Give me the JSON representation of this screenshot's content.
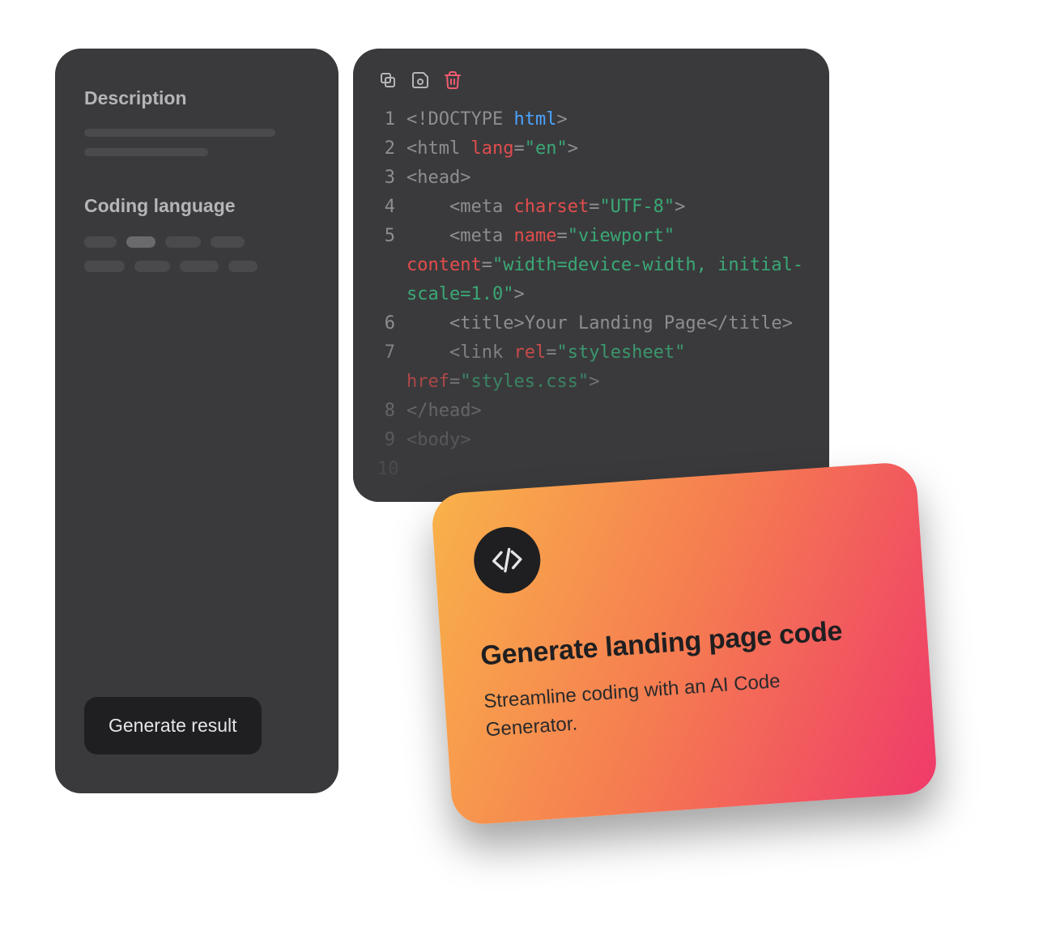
{
  "sidebar": {
    "description_label": "Description",
    "coding_language_label": "Coding language",
    "generate_button": "Generate result"
  },
  "code": {
    "lines": [
      {
        "n": "1",
        "html": "<span class='c-punc'>&lt;!DOCTYPE </span><span class='c-kw'>html</span><span class='c-punc'>&gt;</span>"
      },
      {
        "n": "2",
        "html": "<span class='c-punc'>&lt;</span><span class='c-tag'>html</span> <span class='c-attr'>lang</span><span class='c-punc'>=</span><span class='c-str'>\"en\"</span><span class='c-punc'>&gt;</span>"
      },
      {
        "n": "3",
        "html": "<span class='c-punc'>&lt;</span><span class='c-tag'>head</span><span class='c-punc'>&gt;</span>"
      },
      {
        "n": "4",
        "html": "&nbsp;&nbsp;&nbsp;&nbsp;<span class='c-punc'>&lt;</span><span class='c-tag'>meta</span> <span class='c-attr'>charset</span><span class='c-punc'>=</span><span class='c-str'>\"UTF-8\"</span><span class='c-punc'>&gt;</span>"
      },
      {
        "n": "5",
        "html": "&nbsp;&nbsp;&nbsp;&nbsp;<span class='c-punc'>&lt;</span><span class='c-tag'>meta</span> <span class='c-attr'>name</span><span class='c-punc'>=</span><span class='c-str'>\"viewport\"</span> <span class='c-attr'>content</span><span class='c-punc'>=</span><span class='c-str'>\"width=device-width, initial-scale=1.0\"</span><span class='c-punc'>&gt;</span>",
        "wrap": true
      },
      {
        "n": "6",
        "html": "&nbsp;&nbsp;&nbsp;&nbsp;<span class='c-punc'>&lt;</span><span class='c-tag'>title</span><span class='c-punc'>&gt;</span>Your Landing Page<span class='c-punc'>&lt;/</span><span class='c-tag'>title</span><span class='c-punc'>&gt;</span>"
      },
      {
        "n": "7",
        "html": "&nbsp;&nbsp;&nbsp;&nbsp;<span class='c-punc'>&lt;</span><span class='c-tag'>link</span> <span class='c-attr'>rel</span><span class='c-punc'>=</span><span class='c-str'>\"stylesheet\"</span> <span class='c-attr'>href</span><span class='c-punc'>=</span><span class='c-str'>\"styles.css\"</span><span class='c-punc'>&gt;</span>",
        "wrap": true
      },
      {
        "n": "8",
        "html": "<span class='c-punc'>&lt;/</span><span class='c-tag'>head</span><span class='c-punc'>&gt;</span>"
      },
      {
        "n": "9",
        "html": "<span class='c-punc'>&lt;</span><span class='c-tag'>body</span><span class='c-punc'>&gt;</span>"
      },
      {
        "n": "10",
        "html": ""
      }
    ]
  },
  "promo": {
    "title": "Generate landing page code",
    "subtitle": "Streamline coding with an AI Code Generator."
  }
}
